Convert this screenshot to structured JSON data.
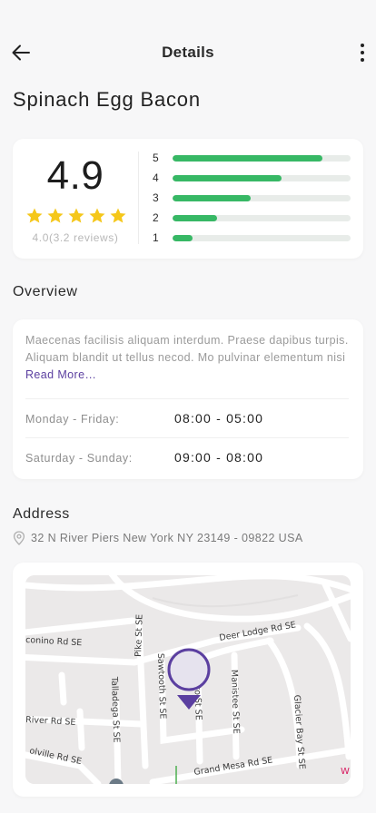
{
  "header": {
    "title": "Details"
  },
  "item": {
    "name": "Spinach Egg Bacon"
  },
  "rating": {
    "score": "4.9",
    "stars_filled": 5,
    "reviews_note": "4.0(3.2 reviews)",
    "bars": [
      {
        "label": "5",
        "fill": 0.84
      },
      {
        "label": "4",
        "fill": 0.61
      },
      {
        "label": "3",
        "fill": 0.44
      },
      {
        "label": "2",
        "fill": 0.25
      },
      {
        "label": "1",
        "fill": 0.11
      }
    ],
    "colors": {
      "star": "#f5c71a",
      "bar": "#37b865",
      "track": "#e8ece9"
    }
  },
  "overview": {
    "heading": "Overview",
    "description": "Maecenas facilisis aliquam interdum. Praese dapibus turpis. Aliquam blandit ut tellus necod. Mo pulvinar elementum nisi ",
    "read_more": "Read More…",
    "hours": [
      {
        "days": "Monday - Friday:",
        "time": "08:00 - 05:00"
      },
      {
        "days": "Saturday - Sunday:",
        "time": "09:00 - 08:00"
      }
    ]
  },
  "address": {
    "heading": "Address",
    "icon": "location-pin-icon",
    "text": "32 N River Piers New York NY 23149 - 09822 USA"
  },
  "map": {
    "accent": "#5b3fa0",
    "streets": [
      "Deer Lodge Rd SE",
      "conino Rd SE",
      "Pike St SE",
      "Sawtooth St SE",
      "Saito St SE",
      "Manistee St SE",
      "Glacier Bay St SE",
      "Talladega St SE",
      "River Rd SE",
      "olville Rd SE",
      "Grand Mesa Rd SE"
    ]
  }
}
